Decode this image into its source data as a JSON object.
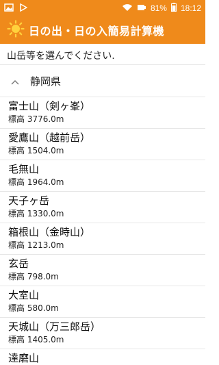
{
  "status": {
    "battery": "81%",
    "time": "18:12"
  },
  "app": {
    "title": "日の出・日の入簡易計算機"
  },
  "instruction": "山岳等を選んでください.",
  "section": {
    "label": "静岡県"
  },
  "mountains": [
    {
      "name": "富士山（剣ヶ峯）",
      "elevation": "標高 3776.0m"
    },
    {
      "name": "愛鷹山（越前岳）",
      "elevation": "標高 1504.0m"
    },
    {
      "name": "毛無山",
      "elevation": "標高 1964.0m"
    },
    {
      "name": "天子ヶ岳",
      "elevation": "標高 1330.0m"
    },
    {
      "name": "箱根山（金時山）",
      "elevation": "標高 1213.0m"
    },
    {
      "name": "玄岳",
      "elevation": "標高 798.0m"
    },
    {
      "name": "大室山",
      "elevation": "標高 580.0m"
    },
    {
      "name": "天城山（万三郎岳）",
      "elevation": "標高 1405.0m"
    },
    {
      "name": "達磨山",
      "elevation": ""
    }
  ],
  "colors": {
    "accent": "#ef8a1b"
  },
  "icons": {
    "status_left": [
      "image-icon",
      "play-store-icon"
    ],
    "status_right": [
      "wifi-icon",
      "signal-icon",
      "battery-icon"
    ],
    "app": "sun-icon",
    "section": "chevron-up-icon"
  }
}
